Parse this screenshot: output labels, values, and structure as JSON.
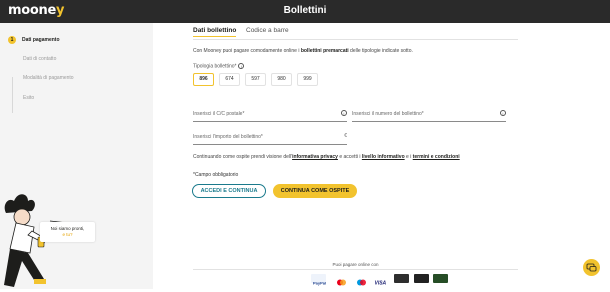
{
  "header": {
    "logo_main": "moone",
    "logo_accent": "y",
    "title": "Bollettini"
  },
  "sidebar": {
    "steps": [
      {
        "num": "1",
        "label": "Dati pagamento",
        "active": true
      },
      {
        "num": "",
        "label": "Dati di contatto",
        "active": false
      },
      {
        "num": "",
        "label": "Modalità di pagamento",
        "active": false
      },
      {
        "num": "",
        "label": "Esito",
        "active": false
      }
    ],
    "bubble_line1": "Noi siamo pronti,",
    "bubble_line2": "e tu?"
  },
  "tabs": [
    {
      "label": "Dati bollettino",
      "active": true
    },
    {
      "label": "Codice a barre",
      "active": false
    }
  ],
  "intro": {
    "prefix": "Con Mooney puoi pagare comodamente online i ",
    "bold": "bollettini premarcati",
    "suffix": " delle tipologie indicate sotto."
  },
  "bill_type": {
    "label": "Tipologia bollettino*",
    "options": [
      "896",
      "674",
      "597",
      "980",
      "999"
    ],
    "selected": "896"
  },
  "fields": {
    "account": "Inserisci il C/C postale*",
    "bill_number": "Inserisci il numero del bollettino*",
    "amount": "Inserisci l'importo del bollettino*",
    "amount_unit": "€"
  },
  "consent": {
    "prefix": "Continuando come ospite prendi visione dell'",
    "link1": "informativa privacy",
    "mid": " e accetti i ",
    "link2": "livello informativo",
    "mid2": " e i ",
    "link3": "termini e condizioni"
  },
  "required_note": "*Campo obbligatorio",
  "buttons": {
    "login": "ACCEDI E CONTINUA",
    "guest": "CONTINUA COME OSPITE"
  },
  "footer": {
    "text": "Puoi pagare online con",
    "methods": [
      "paypal-icon",
      "mastercard-icon",
      "maestro-icon",
      "visa-icon",
      "card-icon",
      "card-icon",
      "card-icon"
    ]
  },
  "colors": {
    "accent": "#f2c32e",
    "header_bg": "#2a2a2a",
    "outline_button": "#1a7a8c"
  }
}
